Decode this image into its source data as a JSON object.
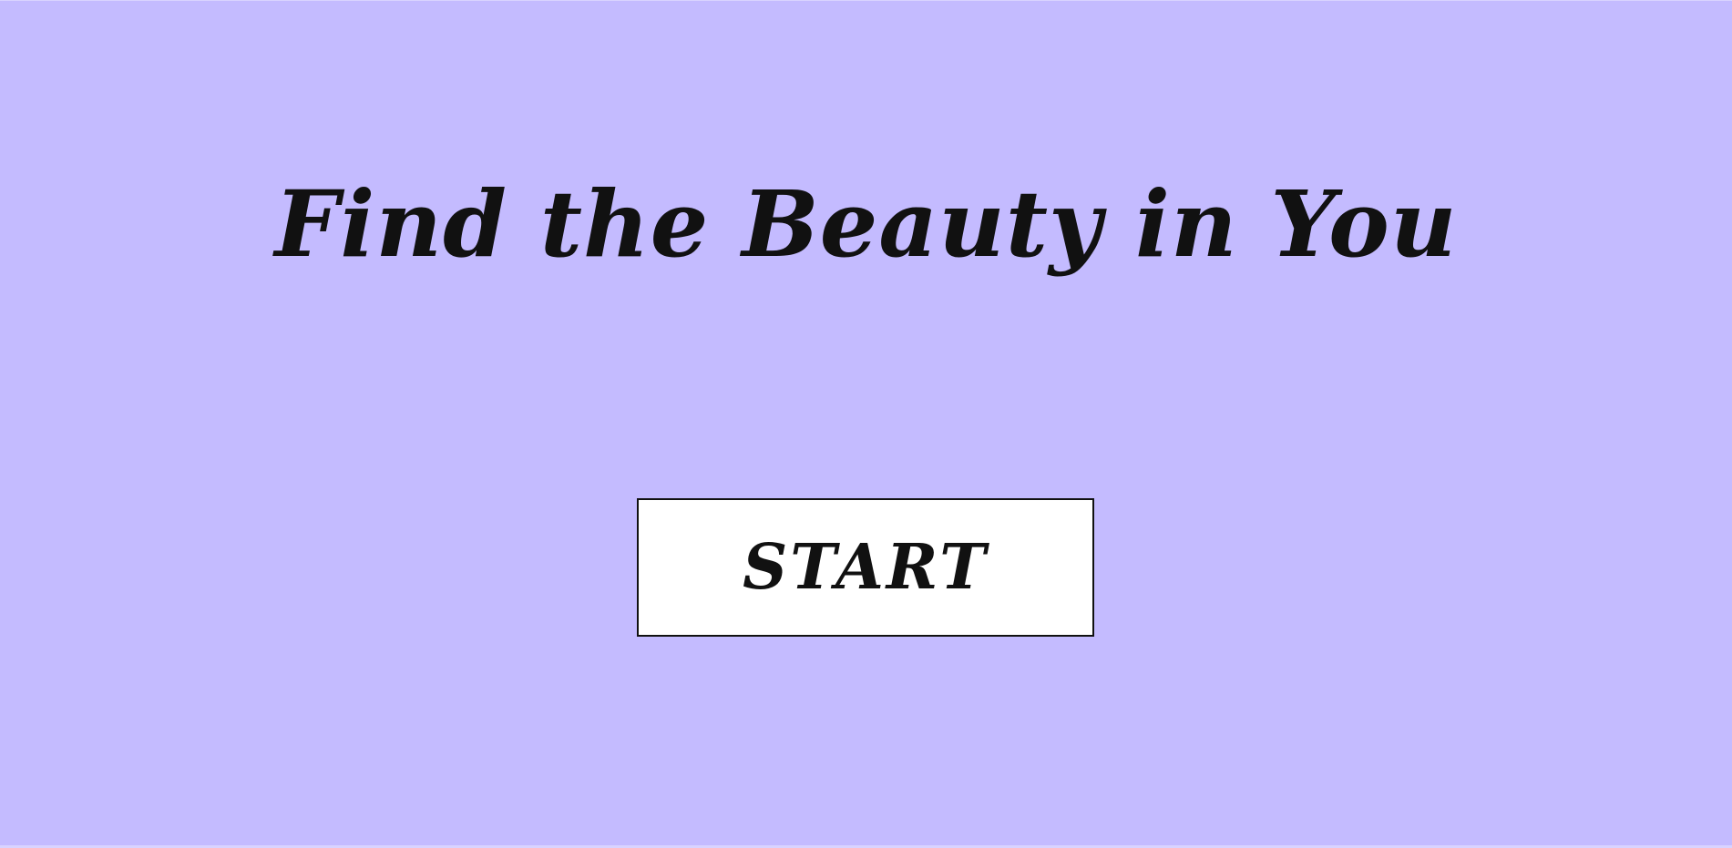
{
  "page": {
    "title": "Find the Beauty in You",
    "start_label": "START",
    "background_color": "#c4bbff"
  }
}
